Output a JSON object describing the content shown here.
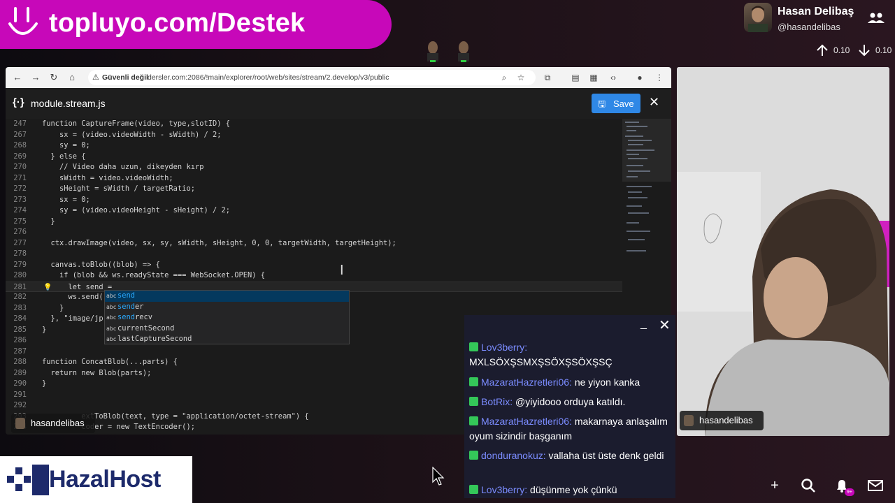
{
  "banner": {
    "brand": "topluyo.com/Destek"
  },
  "profile": {
    "name": "Hasan Delibaş",
    "handle": "@hasandelibas"
  },
  "stats": {
    "up_value": "0.10",
    "down_value": "0.10"
  },
  "browser": {
    "insecure_label": "Güvenli değil",
    "url": "dersler.com:2086/!main/explorer/root/web/sites/stream/2.develop/v3/public"
  },
  "editor": {
    "file_name": "module.stream.js",
    "save_label": "Save",
    "lines": [
      {
        "n": "247",
        "t": "function CaptureFrame(video, type,slotID) {"
      },
      {
        "n": "267",
        "t": "    sx = (video.videoWidth - sWidth) / 2;"
      },
      {
        "n": "268",
        "t": "    sy = 0;"
      },
      {
        "n": "269",
        "t": "  } else {"
      },
      {
        "n": "270",
        "t": "    // Video daha uzun, dikeyden kırp"
      },
      {
        "n": "271",
        "t": "    sWidth = video.videoWidth;"
      },
      {
        "n": "272",
        "t": "    sHeight = sWidth / targetRatio;"
      },
      {
        "n": "273",
        "t": "    sx = 0;"
      },
      {
        "n": "274",
        "t": "    sy = (video.videoHeight - sHeight) / 2;"
      },
      {
        "n": "275",
        "t": "  }"
      },
      {
        "n": "276",
        "t": ""
      },
      {
        "n": "277",
        "t": "  ctx.drawImage(video, sx, sy, sWidth, sHeight, 0, 0, targetWidth, targetHeight);"
      },
      {
        "n": "278",
        "t": ""
      },
      {
        "n": "279",
        "t": "  canvas.toBlob((blob) => {"
      },
      {
        "n": "280",
        "t": "    if (blob && ws.readyState === WebSocket.OPEN) {"
      },
      {
        "n": "281",
        "t": "      let send ="
      },
      {
        "n": "282",
        "t": "      ws.send(                                    tID, 38), blob));"
      },
      {
        "n": "283",
        "t": "    }"
      },
      {
        "n": "284",
        "t": "  }, \"image/jp"
      },
      {
        "n": "285",
        "t": "}"
      },
      {
        "n": "286",
        "t": ""
      },
      {
        "n": "287",
        "t": ""
      },
      {
        "n": "288",
        "t": "function ConcatBlob(...parts) {"
      },
      {
        "n": "289",
        "t": "  return new Blob(parts);"
      },
      {
        "n": "290",
        "t": "}"
      },
      {
        "n": "291",
        "t": ""
      },
      {
        "n": "292",
        "t": ""
      },
      {
        "n": "293",
        "t": "         extToBlob(text, type = \"application/octet-stream\") {"
      },
      {
        "n": "294",
        "t": "         coder = new TextEncoder();"
      }
    ],
    "autocomplete": [
      {
        "kind": "abc",
        "match": "send",
        "rest": ""
      },
      {
        "kind": "abc",
        "match": "send",
        "rest": "er"
      },
      {
        "kind": "abc",
        "match": "send",
        "rest": "recv"
      },
      {
        "kind": "abc",
        "match": "",
        "rest": "currentSecond"
      },
      {
        "kind": "abc",
        "match": "",
        "rest": "lastCaptureSecond"
      }
    ]
  },
  "screen_tag": "hasandelibas",
  "webcam_tag": "hasandelibas",
  "chat": {
    "messages": [
      {
        "user": "Lov3berry:",
        "text": " MXLSÖXŞSMXŞSÖXŞSÖXŞSÇ"
      },
      {
        "user": "MazaratHazretleri06:",
        "text": " ne yiyon kanka"
      },
      {
        "user": "BotRix:",
        "text": " @yiyidooo orduya katıldı."
      },
      {
        "user": "MazaratHazretleri06:",
        "text": " makarnaya anlaşalım oyum sizindir başganım"
      },
      {
        "user": "donduranokuz:",
        "text": " vallaha üst üste denk geldi"
      },
      {
        "user": "Lov3berry:",
        "text": " düşünme yok çünkü"
      }
    ]
  },
  "hazal": {
    "brand": "HazalHost"
  },
  "notif_badge": "9+",
  "icons": [
    "smile-icon",
    "people-icon",
    "arrow-up-icon",
    "arrow-down-icon",
    "back-icon",
    "forward-icon",
    "reload-icon",
    "home-icon",
    "warning-icon",
    "zoom-icon",
    "star-icon",
    "extensions-icon",
    "sidebar-icon",
    "apps-icon",
    "code-icon",
    "profile-icon",
    "menu-icon",
    "braces-icon",
    "save-icon",
    "close-icon",
    "minimize-icon",
    "plus-icon",
    "search-icon",
    "bell-icon",
    "mail-icon"
  ]
}
